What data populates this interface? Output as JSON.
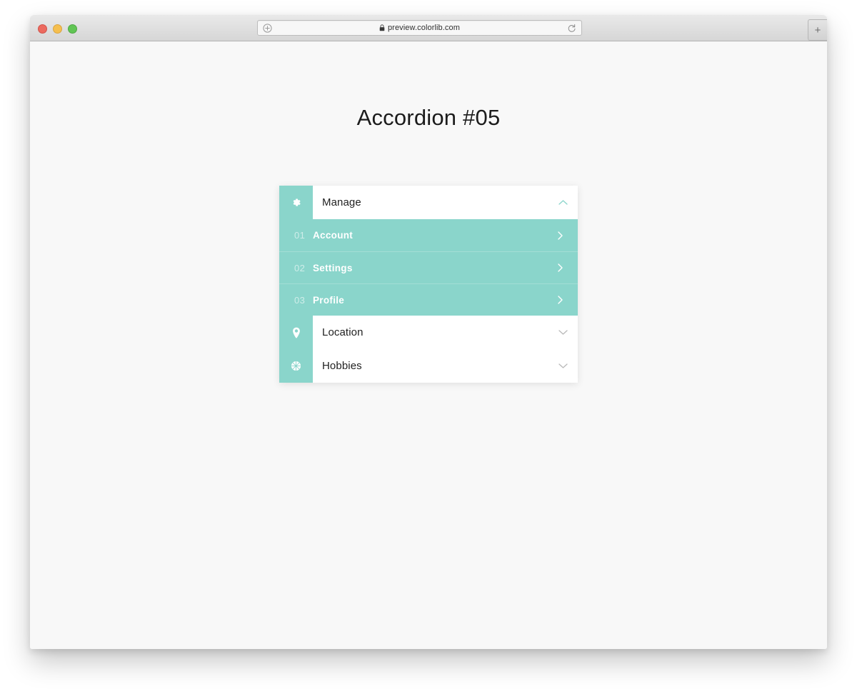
{
  "browser": {
    "traffic_lights": [
      "close-red",
      "minimize-yellow",
      "zoom-green"
    ],
    "url": "preview.colorlib.com",
    "url_lock_icon": "lock-icon",
    "left_icon": "circled-plus-icon",
    "reload_icon": "reload-icon",
    "new_tab_label": "+"
  },
  "page": {
    "title": "Accordion #05"
  },
  "accordion": {
    "items": [
      {
        "label": "Manage",
        "icon": "gear-icon",
        "state": "expanded",
        "chevron": "chevron-up-icon",
        "subitems": [
          {
            "number": "01",
            "label": "Account",
            "arrow": "chevron-right-icon"
          },
          {
            "number": "02",
            "label": "Settings",
            "arrow": "chevron-right-icon"
          },
          {
            "number": "03",
            "label": "Profile",
            "arrow": "chevron-right-icon"
          }
        ]
      },
      {
        "label": "Location",
        "icon": "map-pin-icon",
        "state": "collapsed",
        "chevron": "chevron-down-icon",
        "subitems": []
      },
      {
        "label": "Hobbies",
        "icon": "ball-icon",
        "state": "collapsed",
        "chevron": "chevron-down-icon",
        "subitems": []
      }
    ]
  },
  "colors": {
    "accent_teal": "#8ad5cb",
    "page_background": "#f8f8f8",
    "panel_white": "#ffffff",
    "text_dark": "#1f1f1f",
    "chevron_gray": "#b9b9b9"
  }
}
